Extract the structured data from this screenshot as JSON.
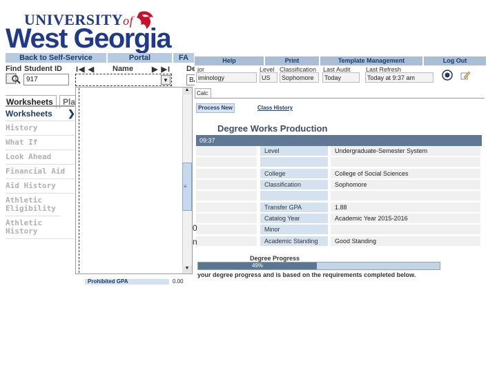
{
  "logo": {
    "line1": "UNIVERSITY",
    "of": "of",
    "line2": "West Georgia",
    "mark_icon": "red-wolf-icon",
    "colors": {
      "blue": "#1f3a8a",
      "red": "#c8102e"
    }
  },
  "top_nav": {
    "back": "Back to Self-Service",
    "portal": "Portal",
    "fa": "FA"
  },
  "search": {
    "find": "Find",
    "student_id_label": "Student ID",
    "student_id_value": "917",
    "name_label": "Name",
    "degree_label": "Degr",
    "degree_value": "BA"
  },
  "tabs": {
    "worksheets": "Worksheets",
    "plans": "Pla"
  },
  "left_nav": [
    "Worksheets",
    "History",
    "What If",
    "Look Ahead",
    "Financial Aid",
    "Aid History",
    "Athletic Eligibility",
    "Athletic History"
  ],
  "right_nav": [
    "Help",
    "Print",
    "Template Management",
    "Log Out"
  ],
  "major": {
    "label": "jor",
    "value": "iminology"
  },
  "student_info": {
    "level_label": "Level",
    "level_value": "US",
    "class_label": "Classification",
    "class_value": "Sophomore",
    "audit_label": "Last Audit",
    "audit_value": "Today",
    "refresh_label": "Last Refresh",
    "refresh_value": "Today at 9:37 am"
  },
  "calc_tab": "Calc",
  "process_new": "Process New",
  "class_history": "Class History",
  "title": "Degree Works Production",
  "timestamp": "09:37",
  "details": [
    {
      "label": "Level",
      "value": "Undergraduate-Semester System"
    },
    {
      "label": "",
      "value": ""
    },
    {
      "label": "College",
      "value": "College of Social Sciences"
    },
    {
      "label": "Classification",
      "value": "Sophomore"
    },
    {
      "label": "",
      "value": ""
    },
    {
      "label": "Transfer GPA",
      "value": "1.88"
    },
    {
      "label": "Catalog Year",
      "value": "Academic Year 2015-2016"
    },
    {
      "label": "Minor",
      "value": ""
    },
    {
      "label": "Academic Standing",
      "value": "Good Standing"
    }
  ],
  "degree_progress": {
    "label": "Degree Progress",
    "percent": 49,
    "percent_text": "49%",
    "note": "your degree progress and is based on the requirements completed below."
  },
  "bottom_cut": {
    "label": "Prohibited GPA",
    "value": "0.00"
  },
  "fragments": {
    "n": "n",
    "zero": "0"
  }
}
